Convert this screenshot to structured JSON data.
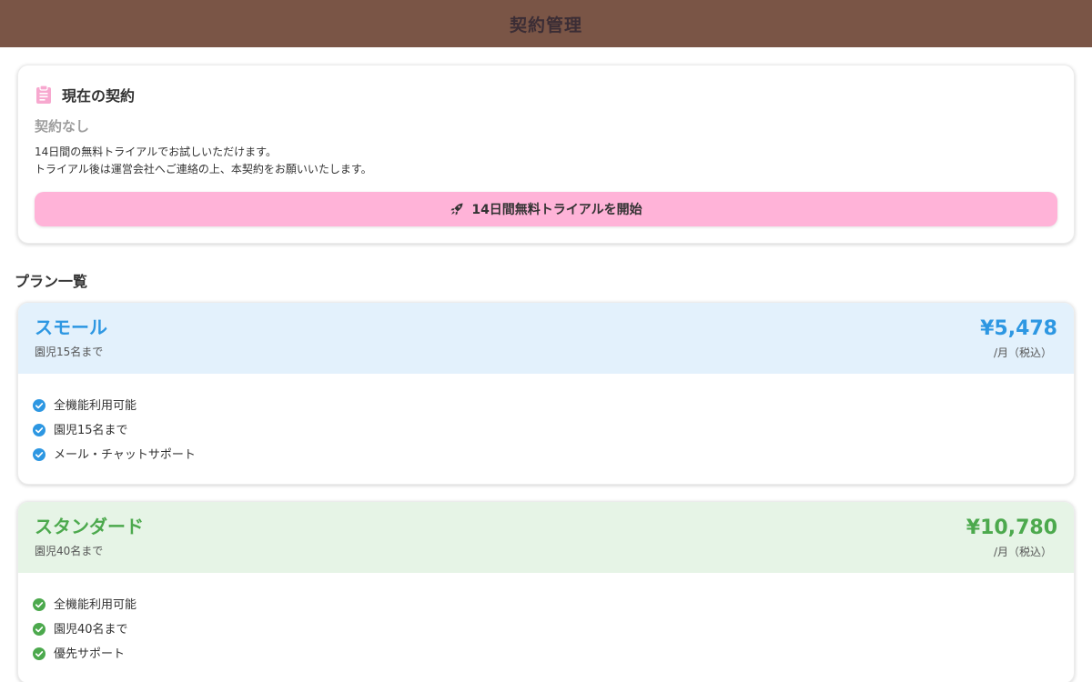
{
  "header": {
    "title": "契約管理"
  },
  "current_contract": {
    "title": "現在の契約",
    "status": "契約なし",
    "description_line1": "14日間の無料トライアルでお試しいただけます。",
    "description_line2": "トライアル後は運営会社へご連絡の上、本契約をお願いいたします。",
    "trial_button_label": "14日間無料トライアルを開始",
    "icon": "clipboard-icon",
    "button_icon": "rocket-icon"
  },
  "plans_section": {
    "title": "プラン一覧"
  },
  "plans": [
    {
      "name": "スモール",
      "subtitle": "園児15名まで",
      "price": "¥5,478",
      "price_unit": "/月（税込）",
      "accent_color": "#2d97e2",
      "header_bg": "#e3f1fc",
      "features": [
        "全機能利用可能",
        "園児15名まで",
        "メール・チャットサポート"
      ]
    },
    {
      "name": "スタンダード",
      "subtitle": "園児40名まで",
      "price": "¥10,780",
      "price_unit": "/月（税込）",
      "accent_color": "#4ca94d",
      "header_bg": "#e6f4e6",
      "features": [
        "全機能利用可能",
        "園児40名まで",
        "優先サポート"
      ]
    }
  ],
  "colors": {
    "header_bg": "#7a5546",
    "trial_button_bg": "#ffb3d8",
    "clipboard_icon": "#f7a8cf"
  }
}
